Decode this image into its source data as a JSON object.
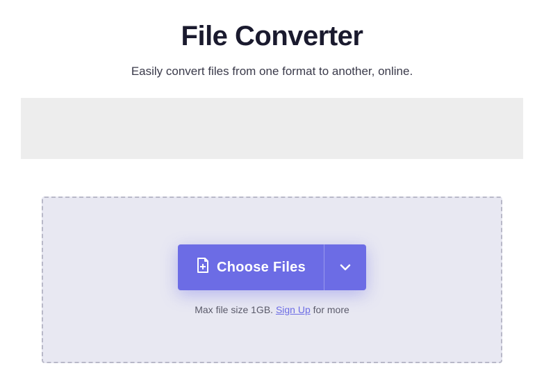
{
  "header": {
    "title": "File Converter",
    "subtitle": "Easily convert files from one format to another, online."
  },
  "dropzone": {
    "choose_label": "Choose Files",
    "hint_prefix": "Max file size 1GB. ",
    "signup_label": "Sign Up",
    "hint_suffix": " for more"
  },
  "colors": {
    "primary": "#6c6ce5"
  }
}
